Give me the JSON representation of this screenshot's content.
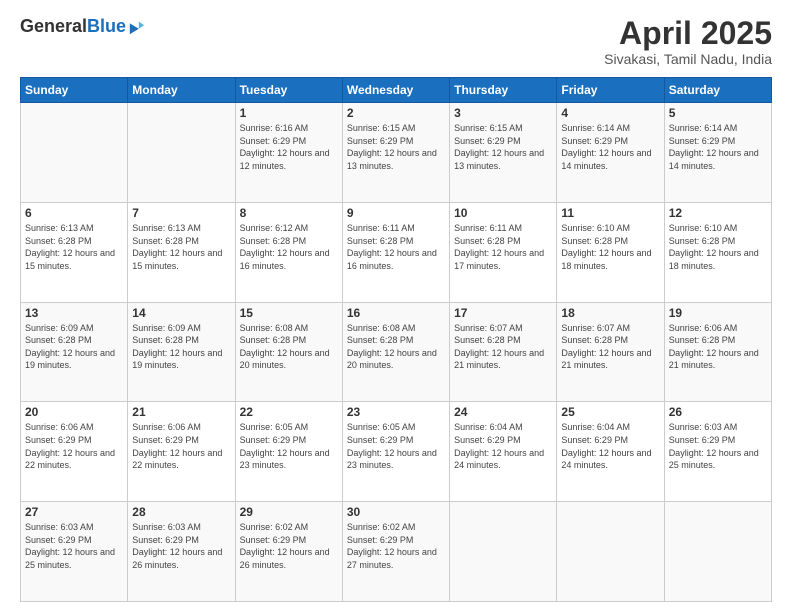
{
  "header": {
    "logo_general": "General",
    "logo_blue": "Blue",
    "month_title": "April 2025",
    "location": "Sivakasi, Tamil Nadu, India"
  },
  "days_of_week": [
    "Sunday",
    "Monday",
    "Tuesday",
    "Wednesday",
    "Thursday",
    "Friday",
    "Saturday"
  ],
  "weeks": [
    [
      {
        "day": "",
        "info": ""
      },
      {
        "day": "",
        "info": ""
      },
      {
        "day": "1",
        "info": "Sunrise: 6:16 AM\nSunset: 6:29 PM\nDaylight: 12 hours and 12 minutes."
      },
      {
        "day": "2",
        "info": "Sunrise: 6:15 AM\nSunset: 6:29 PM\nDaylight: 12 hours and 13 minutes."
      },
      {
        "day": "3",
        "info": "Sunrise: 6:15 AM\nSunset: 6:29 PM\nDaylight: 12 hours and 13 minutes."
      },
      {
        "day": "4",
        "info": "Sunrise: 6:14 AM\nSunset: 6:29 PM\nDaylight: 12 hours and 14 minutes."
      },
      {
        "day": "5",
        "info": "Sunrise: 6:14 AM\nSunset: 6:29 PM\nDaylight: 12 hours and 14 minutes."
      }
    ],
    [
      {
        "day": "6",
        "info": "Sunrise: 6:13 AM\nSunset: 6:28 PM\nDaylight: 12 hours and 15 minutes."
      },
      {
        "day": "7",
        "info": "Sunrise: 6:13 AM\nSunset: 6:28 PM\nDaylight: 12 hours and 15 minutes."
      },
      {
        "day": "8",
        "info": "Sunrise: 6:12 AM\nSunset: 6:28 PM\nDaylight: 12 hours and 16 minutes."
      },
      {
        "day": "9",
        "info": "Sunrise: 6:11 AM\nSunset: 6:28 PM\nDaylight: 12 hours and 16 minutes."
      },
      {
        "day": "10",
        "info": "Sunrise: 6:11 AM\nSunset: 6:28 PM\nDaylight: 12 hours and 17 minutes."
      },
      {
        "day": "11",
        "info": "Sunrise: 6:10 AM\nSunset: 6:28 PM\nDaylight: 12 hours and 18 minutes."
      },
      {
        "day": "12",
        "info": "Sunrise: 6:10 AM\nSunset: 6:28 PM\nDaylight: 12 hours and 18 minutes."
      }
    ],
    [
      {
        "day": "13",
        "info": "Sunrise: 6:09 AM\nSunset: 6:28 PM\nDaylight: 12 hours and 19 minutes."
      },
      {
        "day": "14",
        "info": "Sunrise: 6:09 AM\nSunset: 6:28 PM\nDaylight: 12 hours and 19 minutes."
      },
      {
        "day": "15",
        "info": "Sunrise: 6:08 AM\nSunset: 6:28 PM\nDaylight: 12 hours and 20 minutes."
      },
      {
        "day": "16",
        "info": "Sunrise: 6:08 AM\nSunset: 6:28 PM\nDaylight: 12 hours and 20 minutes."
      },
      {
        "day": "17",
        "info": "Sunrise: 6:07 AM\nSunset: 6:28 PM\nDaylight: 12 hours and 21 minutes."
      },
      {
        "day": "18",
        "info": "Sunrise: 6:07 AM\nSunset: 6:28 PM\nDaylight: 12 hours and 21 minutes."
      },
      {
        "day": "19",
        "info": "Sunrise: 6:06 AM\nSunset: 6:28 PM\nDaylight: 12 hours and 21 minutes."
      }
    ],
    [
      {
        "day": "20",
        "info": "Sunrise: 6:06 AM\nSunset: 6:29 PM\nDaylight: 12 hours and 22 minutes."
      },
      {
        "day": "21",
        "info": "Sunrise: 6:06 AM\nSunset: 6:29 PM\nDaylight: 12 hours and 22 minutes."
      },
      {
        "day": "22",
        "info": "Sunrise: 6:05 AM\nSunset: 6:29 PM\nDaylight: 12 hours and 23 minutes."
      },
      {
        "day": "23",
        "info": "Sunrise: 6:05 AM\nSunset: 6:29 PM\nDaylight: 12 hours and 23 minutes."
      },
      {
        "day": "24",
        "info": "Sunrise: 6:04 AM\nSunset: 6:29 PM\nDaylight: 12 hours and 24 minutes."
      },
      {
        "day": "25",
        "info": "Sunrise: 6:04 AM\nSunset: 6:29 PM\nDaylight: 12 hours and 24 minutes."
      },
      {
        "day": "26",
        "info": "Sunrise: 6:03 AM\nSunset: 6:29 PM\nDaylight: 12 hours and 25 minutes."
      }
    ],
    [
      {
        "day": "27",
        "info": "Sunrise: 6:03 AM\nSunset: 6:29 PM\nDaylight: 12 hours and 25 minutes."
      },
      {
        "day": "28",
        "info": "Sunrise: 6:03 AM\nSunset: 6:29 PM\nDaylight: 12 hours and 26 minutes."
      },
      {
        "day": "29",
        "info": "Sunrise: 6:02 AM\nSunset: 6:29 PM\nDaylight: 12 hours and 26 minutes."
      },
      {
        "day": "30",
        "info": "Sunrise: 6:02 AM\nSunset: 6:29 PM\nDaylight: 12 hours and 27 minutes."
      },
      {
        "day": "",
        "info": ""
      },
      {
        "day": "",
        "info": ""
      },
      {
        "day": "",
        "info": ""
      }
    ]
  ]
}
